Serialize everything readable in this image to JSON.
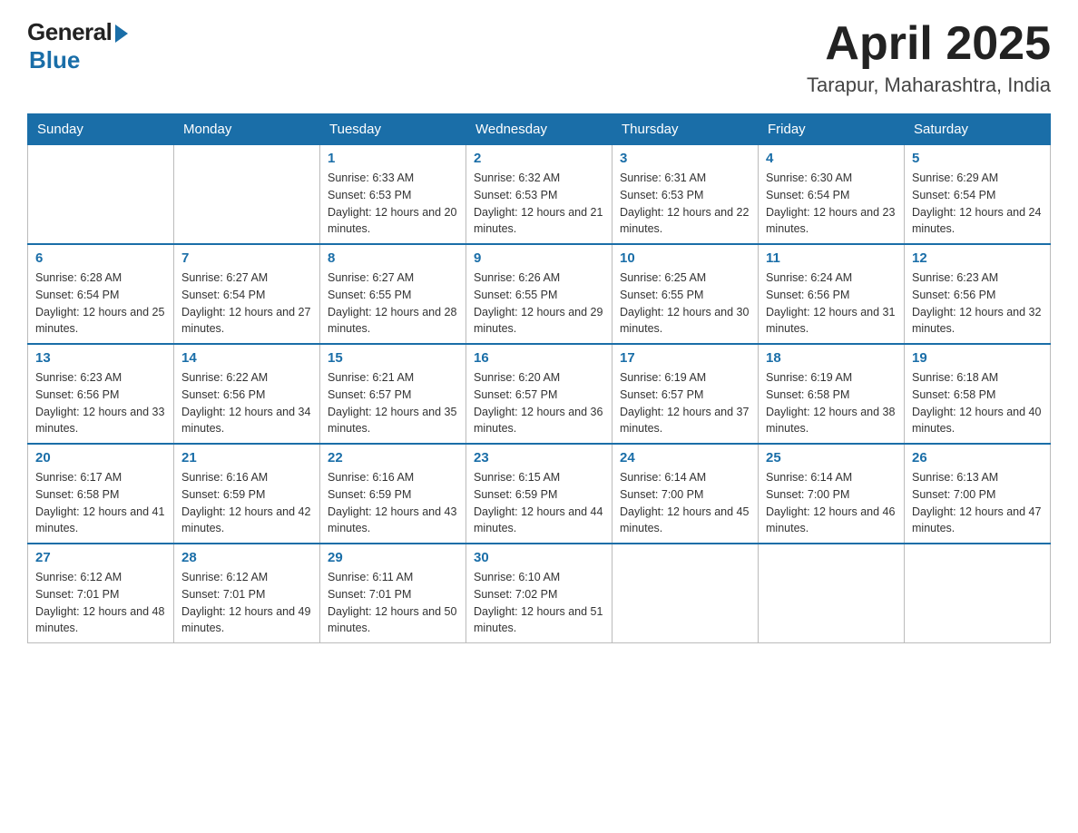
{
  "header": {
    "logo_general": "General",
    "logo_blue": "Blue",
    "title": "April 2025",
    "location": "Tarapur, Maharashtra, India"
  },
  "columns": [
    "Sunday",
    "Monday",
    "Tuesday",
    "Wednesday",
    "Thursday",
    "Friday",
    "Saturday"
  ],
  "weeks": [
    [
      {
        "day": "",
        "sunrise": "",
        "sunset": "",
        "daylight": ""
      },
      {
        "day": "",
        "sunrise": "",
        "sunset": "",
        "daylight": ""
      },
      {
        "day": "1",
        "sunrise": "Sunrise: 6:33 AM",
        "sunset": "Sunset: 6:53 PM",
        "daylight": "Daylight: 12 hours and 20 minutes."
      },
      {
        "day": "2",
        "sunrise": "Sunrise: 6:32 AM",
        "sunset": "Sunset: 6:53 PM",
        "daylight": "Daylight: 12 hours and 21 minutes."
      },
      {
        "day": "3",
        "sunrise": "Sunrise: 6:31 AM",
        "sunset": "Sunset: 6:53 PM",
        "daylight": "Daylight: 12 hours and 22 minutes."
      },
      {
        "day": "4",
        "sunrise": "Sunrise: 6:30 AM",
        "sunset": "Sunset: 6:54 PM",
        "daylight": "Daylight: 12 hours and 23 minutes."
      },
      {
        "day": "5",
        "sunrise": "Sunrise: 6:29 AM",
        "sunset": "Sunset: 6:54 PM",
        "daylight": "Daylight: 12 hours and 24 minutes."
      }
    ],
    [
      {
        "day": "6",
        "sunrise": "Sunrise: 6:28 AM",
        "sunset": "Sunset: 6:54 PM",
        "daylight": "Daylight: 12 hours and 25 minutes."
      },
      {
        "day": "7",
        "sunrise": "Sunrise: 6:27 AM",
        "sunset": "Sunset: 6:54 PM",
        "daylight": "Daylight: 12 hours and 27 minutes."
      },
      {
        "day": "8",
        "sunrise": "Sunrise: 6:27 AM",
        "sunset": "Sunset: 6:55 PM",
        "daylight": "Daylight: 12 hours and 28 minutes."
      },
      {
        "day": "9",
        "sunrise": "Sunrise: 6:26 AM",
        "sunset": "Sunset: 6:55 PM",
        "daylight": "Daylight: 12 hours and 29 minutes."
      },
      {
        "day": "10",
        "sunrise": "Sunrise: 6:25 AM",
        "sunset": "Sunset: 6:55 PM",
        "daylight": "Daylight: 12 hours and 30 minutes."
      },
      {
        "day": "11",
        "sunrise": "Sunrise: 6:24 AM",
        "sunset": "Sunset: 6:56 PM",
        "daylight": "Daylight: 12 hours and 31 minutes."
      },
      {
        "day": "12",
        "sunrise": "Sunrise: 6:23 AM",
        "sunset": "Sunset: 6:56 PM",
        "daylight": "Daylight: 12 hours and 32 minutes."
      }
    ],
    [
      {
        "day": "13",
        "sunrise": "Sunrise: 6:23 AM",
        "sunset": "Sunset: 6:56 PM",
        "daylight": "Daylight: 12 hours and 33 minutes."
      },
      {
        "day": "14",
        "sunrise": "Sunrise: 6:22 AM",
        "sunset": "Sunset: 6:56 PM",
        "daylight": "Daylight: 12 hours and 34 minutes."
      },
      {
        "day": "15",
        "sunrise": "Sunrise: 6:21 AM",
        "sunset": "Sunset: 6:57 PM",
        "daylight": "Daylight: 12 hours and 35 minutes."
      },
      {
        "day": "16",
        "sunrise": "Sunrise: 6:20 AM",
        "sunset": "Sunset: 6:57 PM",
        "daylight": "Daylight: 12 hours and 36 minutes."
      },
      {
        "day": "17",
        "sunrise": "Sunrise: 6:19 AM",
        "sunset": "Sunset: 6:57 PM",
        "daylight": "Daylight: 12 hours and 37 minutes."
      },
      {
        "day": "18",
        "sunrise": "Sunrise: 6:19 AM",
        "sunset": "Sunset: 6:58 PM",
        "daylight": "Daylight: 12 hours and 38 minutes."
      },
      {
        "day": "19",
        "sunrise": "Sunrise: 6:18 AM",
        "sunset": "Sunset: 6:58 PM",
        "daylight": "Daylight: 12 hours and 40 minutes."
      }
    ],
    [
      {
        "day": "20",
        "sunrise": "Sunrise: 6:17 AM",
        "sunset": "Sunset: 6:58 PM",
        "daylight": "Daylight: 12 hours and 41 minutes."
      },
      {
        "day": "21",
        "sunrise": "Sunrise: 6:16 AM",
        "sunset": "Sunset: 6:59 PM",
        "daylight": "Daylight: 12 hours and 42 minutes."
      },
      {
        "day": "22",
        "sunrise": "Sunrise: 6:16 AM",
        "sunset": "Sunset: 6:59 PM",
        "daylight": "Daylight: 12 hours and 43 minutes."
      },
      {
        "day": "23",
        "sunrise": "Sunrise: 6:15 AM",
        "sunset": "Sunset: 6:59 PM",
        "daylight": "Daylight: 12 hours and 44 minutes."
      },
      {
        "day": "24",
        "sunrise": "Sunrise: 6:14 AM",
        "sunset": "Sunset: 7:00 PM",
        "daylight": "Daylight: 12 hours and 45 minutes."
      },
      {
        "day": "25",
        "sunrise": "Sunrise: 6:14 AM",
        "sunset": "Sunset: 7:00 PM",
        "daylight": "Daylight: 12 hours and 46 minutes."
      },
      {
        "day": "26",
        "sunrise": "Sunrise: 6:13 AM",
        "sunset": "Sunset: 7:00 PM",
        "daylight": "Daylight: 12 hours and 47 minutes."
      }
    ],
    [
      {
        "day": "27",
        "sunrise": "Sunrise: 6:12 AM",
        "sunset": "Sunset: 7:01 PM",
        "daylight": "Daylight: 12 hours and 48 minutes."
      },
      {
        "day": "28",
        "sunrise": "Sunrise: 6:12 AM",
        "sunset": "Sunset: 7:01 PM",
        "daylight": "Daylight: 12 hours and 49 minutes."
      },
      {
        "day": "29",
        "sunrise": "Sunrise: 6:11 AM",
        "sunset": "Sunset: 7:01 PM",
        "daylight": "Daylight: 12 hours and 50 minutes."
      },
      {
        "day": "30",
        "sunrise": "Sunrise: 6:10 AM",
        "sunset": "Sunset: 7:02 PM",
        "daylight": "Daylight: 12 hours and 51 minutes."
      },
      {
        "day": "",
        "sunrise": "",
        "sunset": "",
        "daylight": ""
      },
      {
        "day": "",
        "sunrise": "",
        "sunset": "",
        "daylight": ""
      },
      {
        "day": "",
        "sunrise": "",
        "sunset": "",
        "daylight": ""
      }
    ]
  ]
}
